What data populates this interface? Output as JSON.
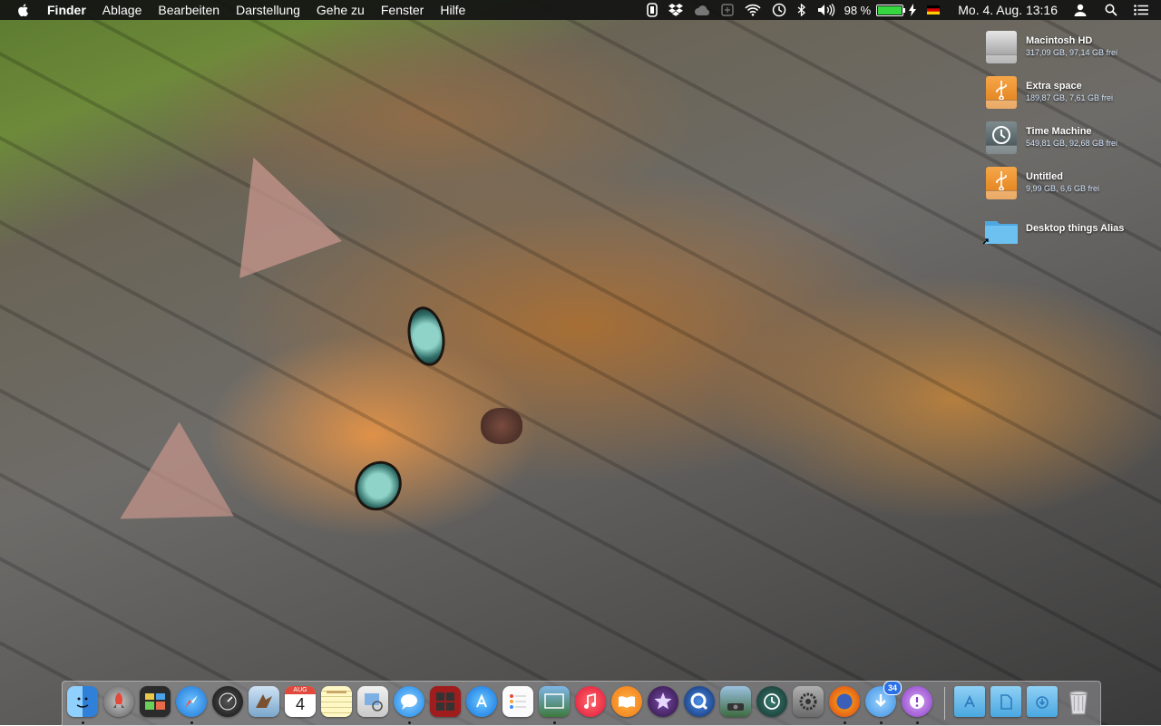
{
  "menubar": {
    "app_name": "Finder",
    "menus": [
      "Ablage",
      "Bearbeiten",
      "Darstellung",
      "Gehe zu",
      "Fenster",
      "Hilfe"
    ],
    "battery_text": "98 %",
    "battery_level": 0.98,
    "clock": "Mo. 4. Aug.  13:16",
    "status_icons": [
      "app-menu-icon",
      "dropbox-icon",
      "cloud-icon",
      "gpu-icon",
      "wifi-icon",
      "time-machine-icon",
      "bluetooth-icon",
      "volume-icon",
      "battery-icon",
      "charging-icon",
      "german-flag-icon",
      "user-icon",
      "spotlight-icon",
      "notification-center-icon"
    ]
  },
  "desktop": {
    "items": [
      {
        "name": "Macintosh HD",
        "info": "317,09 GB, 97,14 GB frei",
        "icon": "hard-drive-icon"
      },
      {
        "name": "Extra space",
        "info": "189,87 GB, 7,61 GB frei",
        "icon": "usb-drive-icon"
      },
      {
        "name": "Time Machine",
        "info": "549,81 GB, 92,68 GB frei",
        "icon": "time-machine-drive-icon"
      },
      {
        "name": "Untitled",
        "info": "9,99 GB, 6,6 GB frei",
        "icon": "usb-drive-icon"
      },
      {
        "name": "Desktop things Alias",
        "info": "",
        "icon": "folder-alias-icon"
      }
    ]
  },
  "dock": {
    "apps": [
      "finder",
      "launchpad",
      "mission-control",
      "safari",
      "dashboard",
      "mail",
      "calendar",
      "notes",
      "preview",
      "messages",
      "photo-booth",
      "app-store",
      "reminders",
      "iphoto",
      "itunes",
      "ibooks",
      "imovie",
      "quicktime",
      "image-capture",
      "time-machine",
      "system-preferences",
      "firefox",
      "downloader",
      "podcast"
    ],
    "calendar_month": "AUG",
    "calendar_day": "4",
    "badge_count": "34",
    "stacks": [
      "applications-folder",
      "documents-folder",
      "downloads-folder",
      "trash"
    ]
  },
  "colors": {
    "menubar_bg": "#121212",
    "battery_fill": "#35d640",
    "folder_blue": "#5fb6ea",
    "usb_orange": "#f29b37"
  }
}
